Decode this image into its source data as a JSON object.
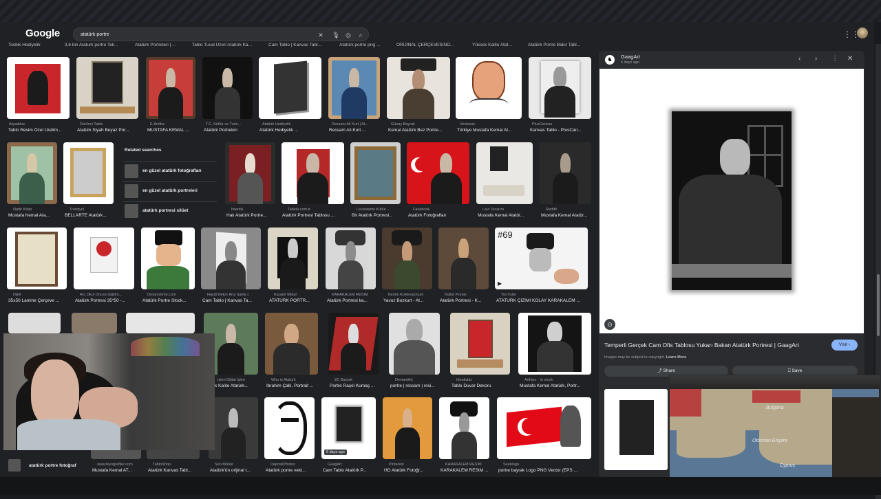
{
  "header": {
    "logo": "Google",
    "search_value": "atatürk portre",
    "icons": [
      "clear-icon",
      "mic-icon",
      "lens-icon",
      "search-icon"
    ]
  },
  "chips": [
    "Tosbik Hediyelik",
    "3,6 bin Ataturk portre Teli...",
    "Atatürk Portreleri | ...",
    "Tablo Tuval Uzeri Atatürk Ka...",
    "Cam Tablo | Kanvas Tabl...",
    "Atatürk portre png ...",
    "ORIJINAL ÇERÇEVESIND...",
    "Yüksek Kalite Atat...",
    "Atatürk Portre Bakır Tabl..."
  ],
  "rows": [
    [
      {
        "src": "Aquablue",
        "title": "Tablo Resim Özel Üretim..."
      },
      {
        "src": "DaVinci Tablo",
        "title": "Atatürk Siyah Beyaz Por..."
      },
      {
        "src": "E-Antika",
        "title": "MUSTAFA KEMAL ..."
      },
      {
        "src": "T.C. Kültür ve Turiz...",
        "title": "Atatürk Portreleri"
      },
      {
        "src": "Atatürk Hediyelik",
        "title": "Atatürk Hediyelik ..."
      },
      {
        "src": "Ressam Ali Kurt | At...",
        "title": "Ressam Ali Kurt ..."
      },
      {
        "src": "Günay Bayrak",
        "title": "Kemal Atatürk Bez Portre..."
      },
      {
        "src": "Vecteezy",
        "title": "Türkiye Mustafa Kemal At..."
      },
      {
        "src": "PlusCanvas",
        "title": "Kanvas Tablo - PlusCan..."
      }
    ],
    [
      {
        "src": "Nadir Kitap",
        "title": "Mustafa Kemal Ata..."
      },
      {
        "src": "Trendyol",
        "title": "BELLARTE Atatürk..."
      },
      {
        "src": "hitantik",
        "title": "Halı Atatürk Portre..."
      },
      {
        "src": "Tabela.com.tr",
        "title": "Atatürk Portresi Tablosu ..."
      },
      {
        "src": "Levantartsi Kültür ...",
        "title": "Bir Atatürk Portresi..."
      },
      {
        "src": "Facebook",
        "title": "Atatürk Fotoğrafları"
      },
      {
        "src": "Levi Tasarım",
        "title": "Mustafa Kemal Atatür..."
      },
      {
        "src": "Reddit",
        "title": "Mustafa Kemal Atatür..."
      }
    ],
    [
      {
        "src": "D&R",
        "title": "35x50 Lamine Çerçeve ..."
      },
      {
        "src": "Arc Okul Öncesi Eğitim...",
        "title": "Atatürk Portresi 35*50 -..."
      },
      {
        "src": "Dreamstime.com",
        "title": "Atatürk Portre Stock..."
      },
      {
        "src": "Haydi Dekor Ana Sayfa |",
        "title": "Cam Tablo | Kanvas Ta..."
      },
      {
        "src": "Karaen Metal",
        "title": "ATATÜRK PORTR..."
      },
      {
        "src": "KARAKALEM RESIM",
        "title": "Atatürk Portresi ka..."
      },
      {
        "src": "Benim Koleksiyonum",
        "title": "Yavuz Bozkurt - At..."
      },
      {
        "src": "Kültür Portalı",
        "title": "Atatürk Portresi - K..."
      },
      {
        "src": "YouTube",
        "title": "ATATÜRK ÇİZİMİ KOLAY KARAKALEM ..."
      }
    ],
    [
      {
        "src": "İşleri Dijital İşleri",
        "title": "k Kalite Atatürk..."
      },
      {
        "src": "Who is Atatürk",
        "title": "İbrahim Çallı, Portrait ..."
      },
      {
        "src": "ZC Bayrak",
        "title": "Portre Raşel Kumaş ..."
      },
      {
        "src": "DeviantArt",
        "title": "portre | ressam | resi..."
      },
      {
        "src": "İdealizbiz",
        "title": "Tablo Duvar Dekoru"
      },
      {
        "src": "Arthipo · In stock",
        "title": "Mustafa Kemal Atatürk, Portr..."
      }
    ],
    [
      {
        "src": "www.biyografiler.com",
        "title": "Mustafa Kemal AT..."
      },
      {
        "src": "TabloShop",
        "title": "Atatürk Kanvas Tabl..."
      },
      {
        "src": "Son Mühür",
        "title": "Atatürk'ün orijinal t..."
      },
      {
        "src": "DepositPhotos",
        "title": "Atatürk portre vekt..."
      },
      {
        "src": "GaagArt",
        "title": "Cam Tablo Atatürk P..."
      },
      {
        "src": "Pinterest",
        "title": "HD Atatürk Fotoğr..."
      },
      {
        "src": "KARAKALEM RESIM",
        "title": "KARAKALEM RESIM ..."
      },
      {
        "src": "Seeklogo",
        "title": "portre bayrak Logo PNG Vector (EPS ..."
      }
    ]
  ],
  "badges": {
    "days_ago": "6 days ago",
    "number": "#69"
  },
  "related": {
    "heading": "Related searches",
    "items": [
      "en güzel atatürk fotoğrafları",
      "en güzel atatürk portreleri",
      "atatürk portresi silüet"
    ],
    "bottom_item": "atatürk portre fotoğraf"
  },
  "panel": {
    "site": "GaagArt",
    "time": "6 days ago",
    "title": "Temperli Gerçek Cam Ofis Tablosu Yukarı Bakan Atatürk Portresi | GaagArt",
    "visit": "Visit",
    "note": "Images may be subject to copyright.",
    "learn_more": "Learn More",
    "share": "Share",
    "save": "Save"
  },
  "game": {
    "labels": [
      "Bulgaria",
      "Ottoman Empire",
      "Cyprus"
    ]
  },
  "colors": {
    "accent": "#8ab4f8",
    "background": "#202124",
    "panel": "#2b2c2f"
  }
}
